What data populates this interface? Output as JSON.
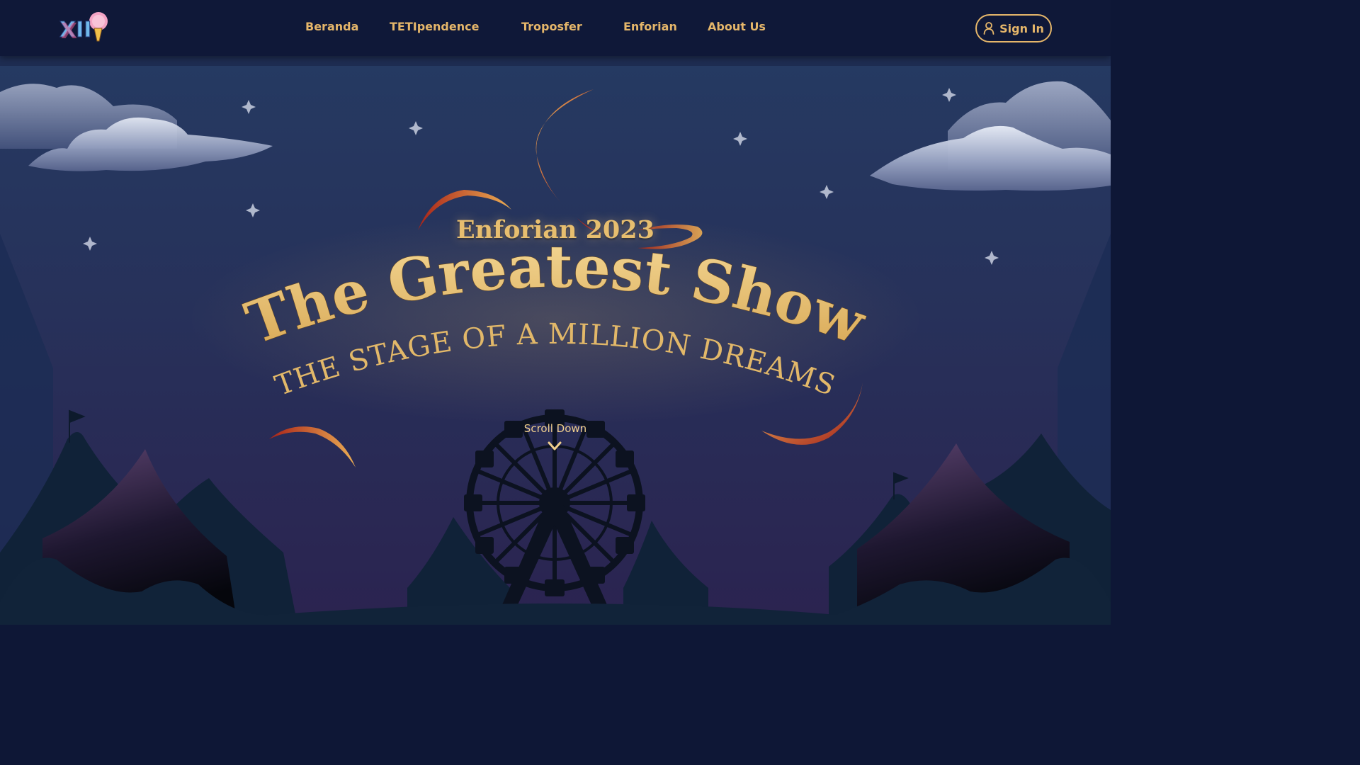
{
  "nav": {
    "logo_text": "XII",
    "items": [
      {
        "label": "Beranda"
      },
      {
        "label": "TETIpendence"
      },
      {
        "label": "Troposfer"
      },
      {
        "label": "Enforian"
      },
      {
        "label": "About Us"
      }
    ],
    "signin_label": "Sign In"
  },
  "hero": {
    "event": "Enforian 2023",
    "title": "The Greatest  Show",
    "tagline": "THE STAGE OF A MILLION DREAMS",
    "scroll_label": "Scroll Down"
  },
  "icons": {
    "signin": "user-icon",
    "scroll": "chevron-down-icon"
  },
  "colors": {
    "nav_bg": "#0f1838",
    "accent_gold": "#e5b66a",
    "sky_top": "#24375f",
    "sky_bottom": "#2a2450",
    "crescent_red": "#b8271c",
    "crescent_orange": "#e5a046"
  }
}
